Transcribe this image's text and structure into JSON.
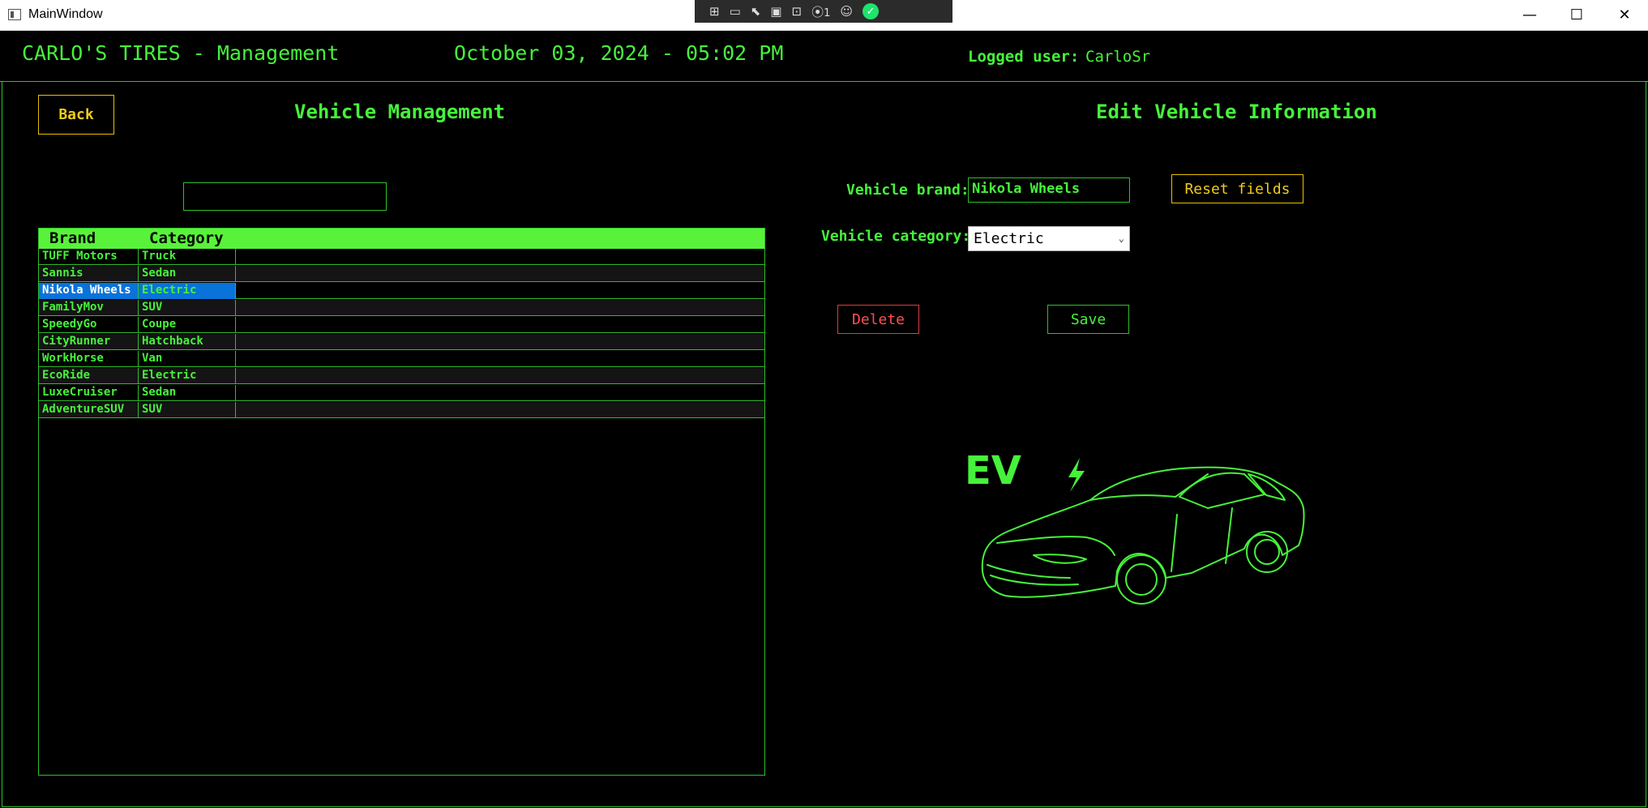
{
  "window": {
    "title": "MainWindow",
    "minimize": "—",
    "maximize": "☐",
    "close": "✕"
  },
  "devbar": {
    "badge_count": "1",
    "ok": "✓"
  },
  "header": {
    "app_title": "CARLO'S TIRES - Management",
    "datetime": "October 03, 2024 - 05:02 PM",
    "logged_label": "Logged user:",
    "logged_user": "CarloSr"
  },
  "left": {
    "back_label": "Back",
    "title": "Vehicle Management",
    "search_value": ""
  },
  "grid": {
    "columns": [
      "Brand",
      "Category"
    ],
    "rows": [
      {
        "brand": "TUFF Motors",
        "category": "Truck"
      },
      {
        "brand": "Sannis",
        "category": "Sedan"
      },
      {
        "brand": "Nikola Wheels",
        "category": "Electric",
        "selected": true
      },
      {
        "brand": "FamilyMov",
        "category": "SUV"
      },
      {
        "brand": "SpeedyGo",
        "category": "Coupe"
      },
      {
        "brand": "CityRunner",
        "category": "Hatchback"
      },
      {
        "brand": "WorkHorse",
        "category": "Van"
      },
      {
        "brand": "EcoRide",
        "category": "Electric"
      },
      {
        "brand": "LuxeCruiser",
        "category": "Sedan"
      },
      {
        "brand": "AdventureSUV",
        "category": "SUV"
      }
    ]
  },
  "right": {
    "title": "Edit Vehicle Information",
    "brand_label": "Vehicle brand:",
    "brand_value": "Nikola Wheels",
    "category_label": "Vehicle category:",
    "category_value": "Electric",
    "reset_label": "Reset fields",
    "delete_label": "Delete",
    "save_label": "Save"
  },
  "image": {
    "logo_text": "EV",
    "icon": "ev-car-illustration"
  },
  "colors": {
    "accent": "#46f23b",
    "button_yellow": "#f0cc19",
    "danger": "#ff5050",
    "selection": "#0a73d9"
  }
}
